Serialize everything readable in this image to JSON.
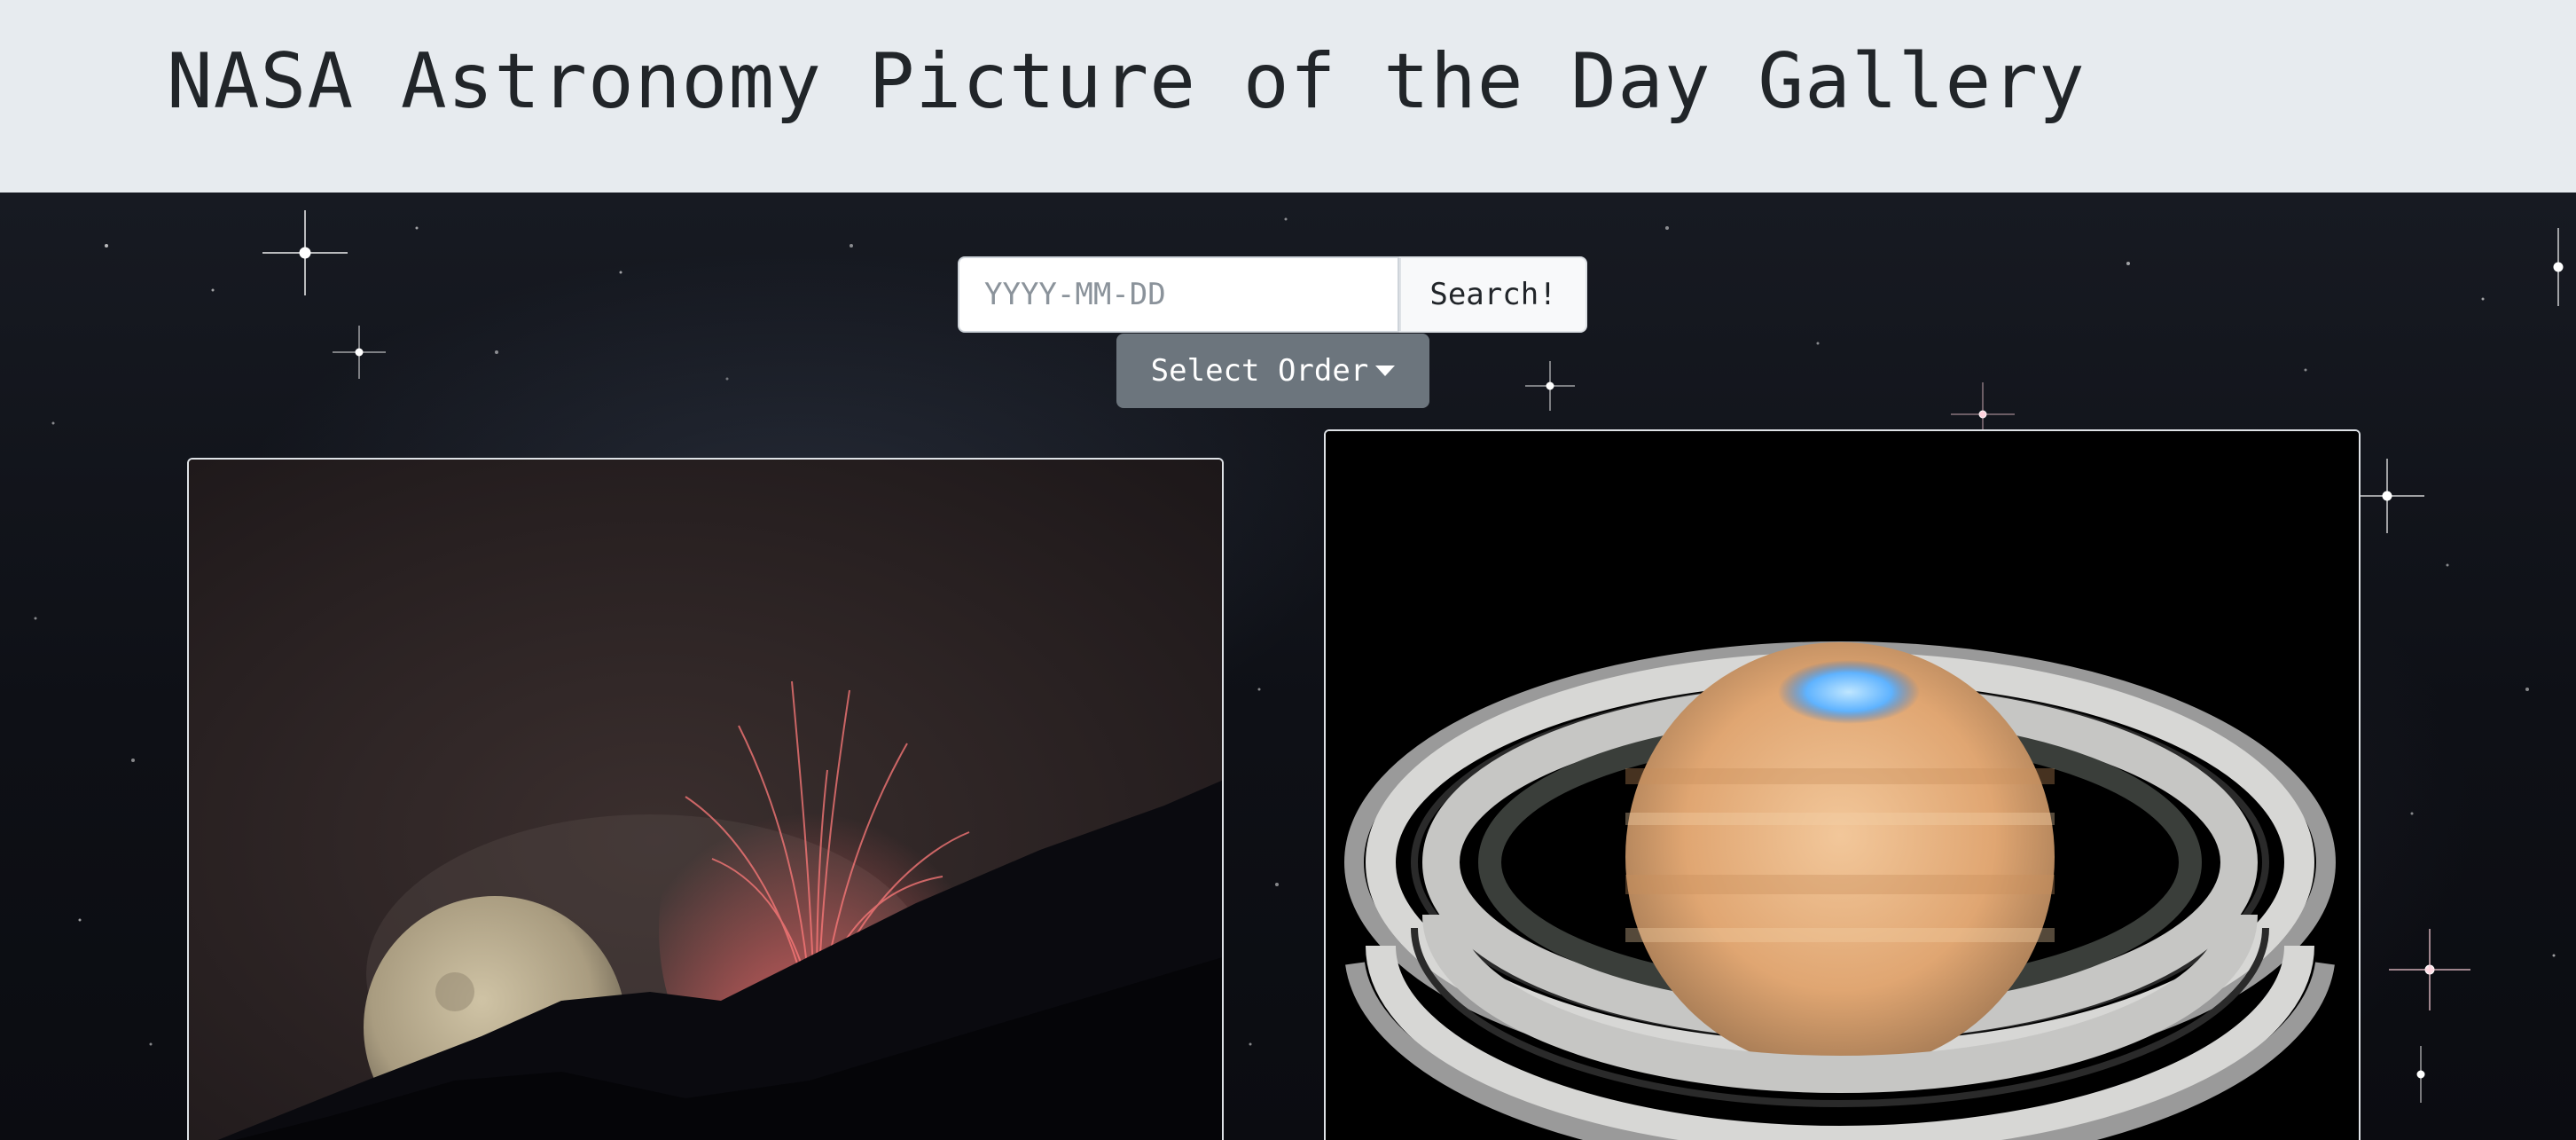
{
  "header": {
    "title": "NASA Astronomy Picture of the Day Gallery"
  },
  "search": {
    "placeholder": "YYYY-MM-DD",
    "value": "",
    "button_label": "Search!"
  },
  "order_dropdown": {
    "label": "Select Order"
  },
  "colors": {
    "header_bg": "#e7ebef",
    "title_text": "#212529",
    "order_button_bg": "#6c757d",
    "search_button_bg": "#f8f9fa",
    "card_border": "#dee2e6"
  },
  "icons": {
    "dropdown_caret": "caret-down-icon"
  }
}
